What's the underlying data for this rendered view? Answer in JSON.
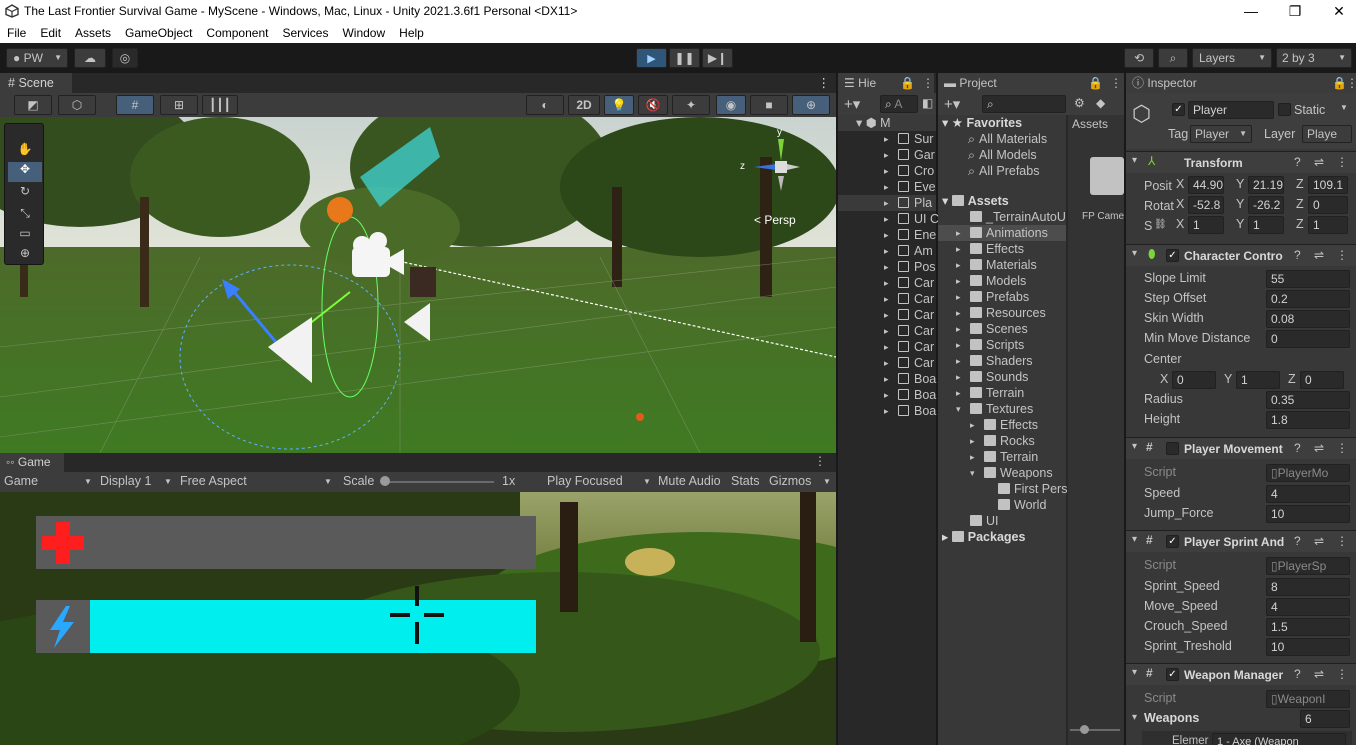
{
  "window": {
    "title": "The Last Frontier Survival Game - MyScene - Windows, Mac, Linux - Unity 2021.3.6f1 Personal <DX11>",
    "minimize": "—",
    "maximize": "❐",
    "close": "✕"
  },
  "menu": [
    "File",
    "Edit",
    "Assets",
    "GameObject",
    "Component",
    "Services",
    "Window",
    "Help"
  ],
  "toolbar": {
    "account": "PW",
    "layers": "Layers",
    "layout": "2 by 3"
  },
  "scene": {
    "tab": "Scene",
    "mode_2d": "2D",
    "persp": "< Persp",
    "gizmo_y": "y",
    "gizmo_z": "z"
  },
  "game": {
    "tab": "Game",
    "display_mode": "Game",
    "display": "Display 1",
    "aspect": "Free Aspect",
    "scale_label": "Scale",
    "scale_value": "1x",
    "play_focused": "Play Focused",
    "mute": "Mute Audio",
    "stats": "Stats",
    "gizmos": "Gizmos",
    "health_fraction": 0,
    "stamina_fraction": 0.9,
    "health_color": "#ff1e1e",
    "stamina_color": "#00eeee"
  },
  "hierarchy": {
    "tab": "Hie",
    "search": "A",
    "scene_name": "M",
    "items": [
      "Sur",
      "Gar",
      "Cro",
      "Eve",
      "Pla",
      "UI C",
      "Ene",
      "Am",
      "Pos",
      "Car",
      "Car",
      "Car",
      "Car",
      "Car",
      "Car",
      "Boa",
      "Boa",
      "Boa"
    ]
  },
  "project": {
    "tab": "Project",
    "favorites_label": "Favorites",
    "favorites": [
      "All Materials",
      "All Models",
      "All Prefabs"
    ],
    "assets_label": "Assets",
    "assets": [
      "_TerrainAutoU",
      "Animations",
      "Effects",
      "Materials",
      "Models",
      "Prefabs",
      "Resources",
      "Scenes",
      "Scripts",
      "Shaders",
      "Sounds",
      "Terrain",
      "Textures"
    ],
    "textures_children": [
      "Effects",
      "Rocks",
      "Terrain",
      "Weapons"
    ],
    "weapons_children": [
      "First Pers",
      "World"
    ],
    "ui_label": "UI",
    "packages_label": "Packages",
    "breadcrumb": "Assets",
    "file_item": "FP Came"
  },
  "inspector": {
    "tab": "Inspector",
    "object_name": "Player",
    "static_label": "Static",
    "tag_label": "Tag",
    "tag_value": "Player",
    "layer_label": "Layer",
    "layer_value": "Playe",
    "transform": {
      "title": "Transform",
      "position_label": "Posit",
      "rotation_label": "Rotat",
      "scale_label": "S",
      "pos": [
        "44.90",
        "21.195",
        "109.1"
      ],
      "rot": [
        "-52.8",
        "-26.2",
        "0"
      ],
      "scale": [
        "1",
        "1",
        "1"
      ]
    },
    "character_controller": {
      "title": "Character Contro",
      "rows": [
        {
          "label": "Slope Limit",
          "value": "55"
        },
        {
          "label": "Step Offset",
          "value": "0.2"
        },
        {
          "label": "Skin Width",
          "value": "0.08"
        },
        {
          "label": "Min Move Distance",
          "value": "0"
        }
      ],
      "center_label": "Center",
      "center": [
        "0",
        "1",
        "0"
      ],
      "radius_label": "Radius",
      "radius": "0.35",
      "height_label": "Height",
      "height": "1.8"
    },
    "player_movement": {
      "title": "Player Movement",
      "script_label": "Script",
      "script": "PlayerMo",
      "rows": [
        {
          "label": "Speed",
          "value": "4"
        },
        {
          "label": "Jump_Force",
          "value": "10"
        }
      ]
    },
    "player_sprint": {
      "title": "Player Sprint And",
      "script_label": "Script",
      "script": "PlayerSp",
      "rows": [
        {
          "label": "Sprint_Speed",
          "value": "8"
        },
        {
          "label": "Move_Speed",
          "value": "4"
        },
        {
          "label": "Crouch_Speed",
          "value": "1.5"
        },
        {
          "label": "Sprint_Treshold",
          "value": "10"
        }
      ]
    },
    "weapon_manager": {
      "title": "Weapon Manager",
      "script_label": "Script",
      "script": "WeaponI",
      "weapons_label": "Weapons",
      "weapons_count": "6",
      "element_label": "Elemer",
      "element_value": "1 - Axe (Weapon"
    }
  }
}
